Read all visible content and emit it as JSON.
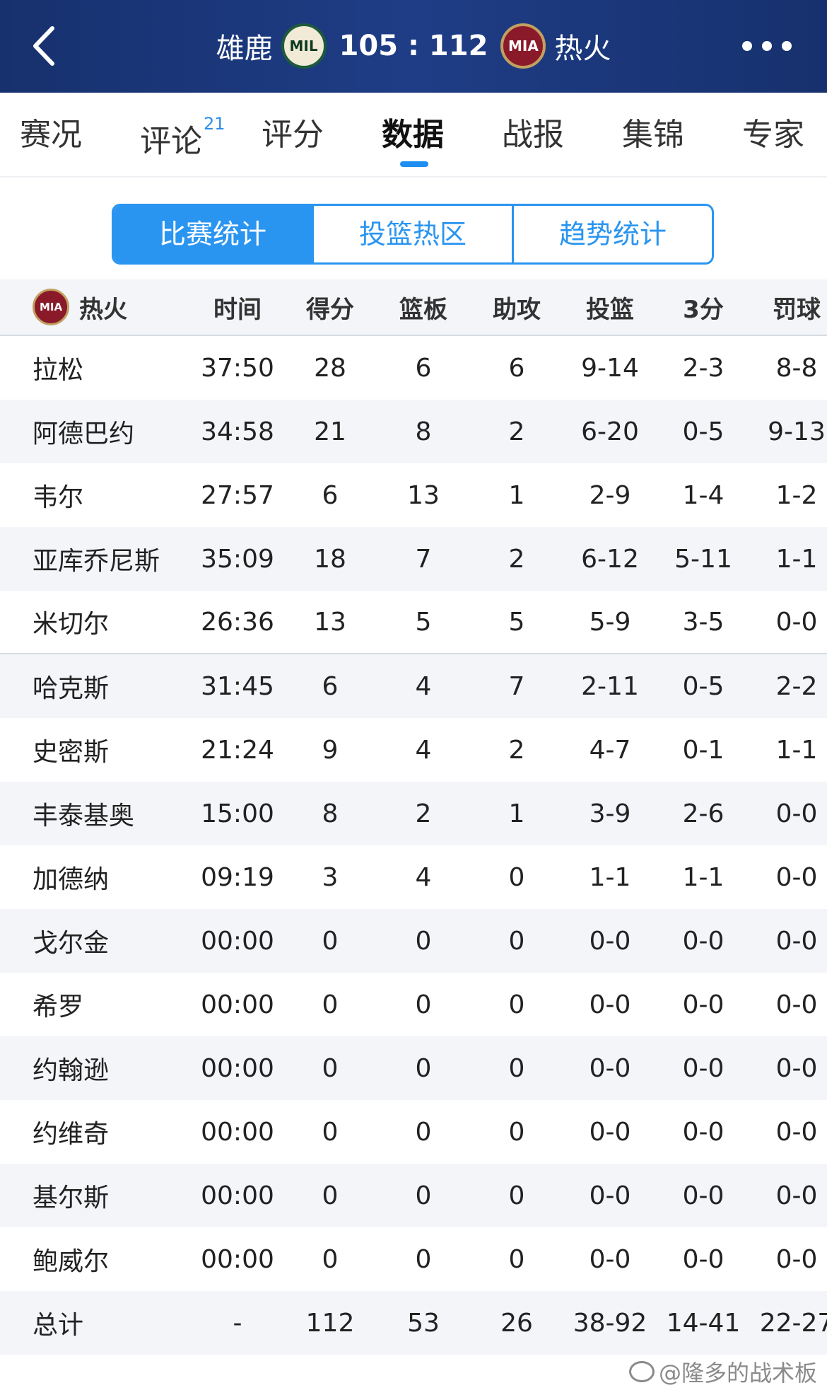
{
  "header": {
    "home_team": "雄鹿",
    "home_logo": "MIL",
    "score": "105 : 112",
    "away_logo": "MIA",
    "away_team": "热火"
  },
  "tabs": [
    {
      "label": "赛况"
    },
    {
      "label": "评论",
      "badge": "21"
    },
    {
      "label": "评分"
    },
    {
      "label": "数据",
      "active": true
    },
    {
      "label": "战报"
    },
    {
      "label": "集锦"
    },
    {
      "label": "专家"
    }
  ],
  "segments": [
    {
      "label": "比赛统计",
      "active": true
    },
    {
      "label": "投篮热区"
    },
    {
      "label": "趋势统计"
    }
  ],
  "table": {
    "team_logo": "MIA",
    "team_name": "热火",
    "columns": [
      "时间",
      "得分",
      "篮板",
      "助攻",
      "投篮",
      "3分",
      "罚球"
    ],
    "rows": [
      [
        "拉松",
        "37:50",
        "28",
        "6",
        "6",
        "9-14",
        "2-3",
        "8-8"
      ],
      [
        "阿德巴约",
        "34:58",
        "21",
        "8",
        "2",
        "6-20",
        "0-5",
        "9-13"
      ],
      [
        "韦尔",
        "27:57",
        "6",
        "13",
        "1",
        "2-9",
        "1-4",
        "1-2"
      ],
      [
        "亚库乔尼斯",
        "35:09",
        "18",
        "7",
        "2",
        "6-12",
        "5-11",
        "1-1"
      ],
      [
        "米切尔",
        "26:36",
        "13",
        "5",
        "5",
        "5-9",
        "3-5",
        "0-0"
      ],
      [
        "哈克斯",
        "31:45",
        "6",
        "4",
        "7",
        "2-11",
        "0-5",
        "2-2"
      ],
      [
        "史密斯",
        "21:24",
        "9",
        "4",
        "2",
        "4-7",
        "0-1",
        "1-1"
      ],
      [
        "丰泰基奥",
        "15:00",
        "8",
        "2",
        "1",
        "3-9",
        "2-6",
        "0-0"
      ],
      [
        "加德纳",
        "09:19",
        "3",
        "4",
        "0",
        "1-1",
        "1-1",
        "0-0"
      ],
      [
        "戈尔金",
        "00:00",
        "0",
        "0",
        "0",
        "0-0",
        "0-0",
        "0-0"
      ],
      [
        "希罗",
        "00:00",
        "0",
        "0",
        "0",
        "0-0",
        "0-0",
        "0-0"
      ],
      [
        "约翰逊",
        "00:00",
        "0",
        "0",
        "0",
        "0-0",
        "0-0",
        "0-0"
      ],
      [
        "约维奇",
        "00:00",
        "0",
        "0",
        "0",
        "0-0",
        "0-0",
        "0-0"
      ],
      [
        "基尔斯",
        "00:00",
        "0",
        "0",
        "0",
        "0-0",
        "0-0",
        "0-0"
      ],
      [
        "鲍威尔",
        "00:00",
        "0",
        "0",
        "0",
        "0-0",
        "0-0",
        "0-0"
      ]
    ],
    "total": [
      "总计",
      "-",
      "112",
      "53",
      "26",
      "38-92",
      "14-41",
      "22-27"
    ]
  },
  "watermark": "@隆多的战术板",
  "colors": {
    "header_bg": "#1f3d86",
    "accent": "#2a95f1",
    "row_alt": "#f3f5f9"
  }
}
